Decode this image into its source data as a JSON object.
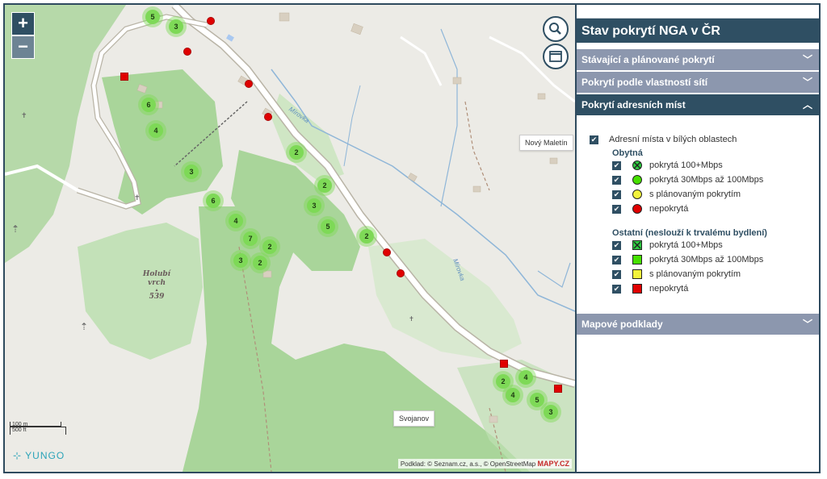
{
  "map": {
    "zoom_in": "+",
    "zoom_out": "−",
    "search_icon": "search-icon",
    "layers_icon": "calendar-icon",
    "places": {
      "novy_maletin": "Nový Maletín",
      "svojanov": "Svojanov"
    },
    "peak": {
      "name1": "Holubí",
      "name2": "vrch",
      "elevation": "539"
    },
    "streams": {
      "mirovka_1": "Mírovka",
      "mirovka_2": "Mírovka"
    },
    "clusters": [
      "5",
      "3",
      "6",
      "4",
      "2",
      "3",
      "6",
      "4",
      "7",
      "2",
      "3",
      "2",
      "2",
      "3",
      "5",
      "2",
      "2",
      "4",
      "4",
      "5",
      "3"
    ],
    "scale": {
      "metric": "100 m",
      "imperial": "500 ft"
    },
    "brand": "YUNGO",
    "attribution": "Podklad: © Seznam.cz, a.s., © OpenStreetMap",
    "attribution_logo": "MAPY.CZ",
    "colors": {
      "covered_high": "#2ecc40",
      "covered_mid": "#46e000",
      "planned": "#f2f23c",
      "uncovered": "#e00000",
      "panel_dark": "#2f4f63",
      "panel_header": "#8c97ae"
    }
  },
  "panel": {
    "title": "Stav pokrytí NGA v ČR",
    "sections": [
      {
        "label": "Stávající a plánované pokrytí",
        "state": "collapsed"
      },
      {
        "label": "Pokrytí podle vlastností sítí",
        "state": "collapsed"
      },
      {
        "label": "Pokrytí adresních míst",
        "state": "expanded"
      },
      {
        "label": "Mapové podklady",
        "state": "collapsed"
      }
    ],
    "layers": {
      "main": "Adresní místa v bílých oblastech",
      "residential": {
        "title": "Obytná",
        "items": [
          "pokrytá 100+Mbps",
          "pokrytá 30Mbps až 100Mbps",
          "s plánovaným pokrytím",
          "nepokrytá"
        ]
      },
      "other": {
        "title": "Ostatní (neslouží k trvalému bydlení)",
        "items": [
          "pokrytá 100+Mbps",
          "pokrytá 30Mbps až 100Mbps",
          "s plánovaným pokrytím",
          "nepokrytá"
        ]
      }
    }
  }
}
